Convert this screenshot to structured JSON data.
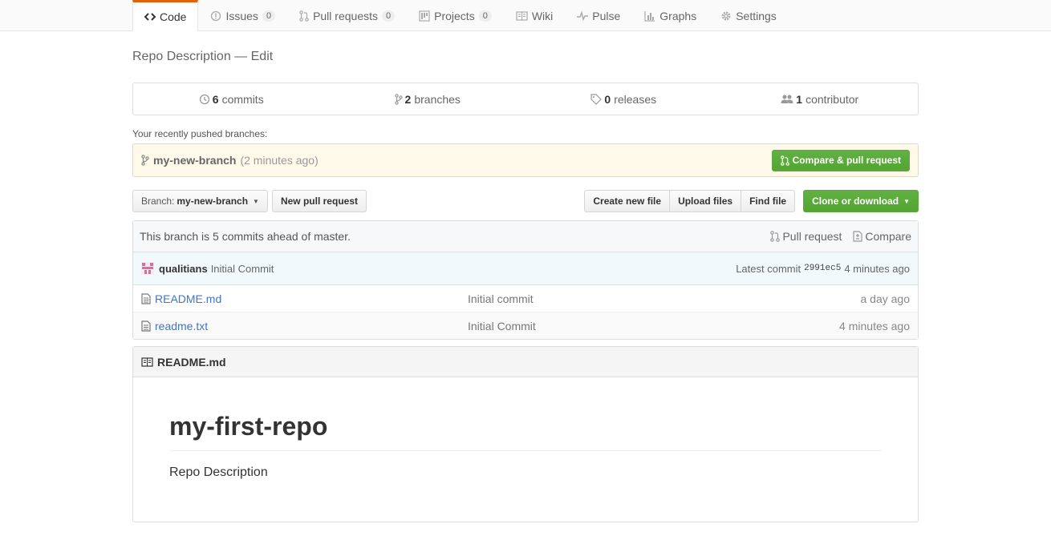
{
  "nav": {
    "tabs": [
      {
        "label": "Code",
        "counter": null,
        "icon": "code-icon",
        "selected": true
      },
      {
        "label": "Issues",
        "counter": "0",
        "icon": "issue-icon"
      },
      {
        "label": "Pull requests",
        "counter": "0",
        "icon": "pull-request-icon"
      },
      {
        "label": "Projects",
        "counter": "0",
        "icon": "project-icon"
      },
      {
        "label": "Wiki",
        "counter": null,
        "icon": "book-icon"
      },
      {
        "label": "Pulse",
        "counter": null,
        "icon": "pulse-icon"
      },
      {
        "label": "Graphs",
        "counter": null,
        "icon": "graph-icon"
      },
      {
        "label": "Settings",
        "counter": null,
        "icon": "gear-icon"
      }
    ],
    "accent": "#e36209"
  },
  "repo": {
    "description": "Repo Description",
    "edit_sep": " — ",
    "edit_label": "Edit"
  },
  "summary": {
    "commits_count": "6",
    "commits_label": "commits",
    "branches_count": "2",
    "branches_label": "branches",
    "releases_count": "0",
    "releases_label": "releases",
    "contributors_count": "1",
    "contributors_label": "contributor"
  },
  "recent": {
    "label": "Your recently pushed branches:",
    "branch": "my-new-branch",
    "ago": "(2 minutes ago)",
    "compare_button": "Compare & pull request"
  },
  "toolbar": {
    "branch_prefix": "Branch:",
    "branch_name": "my-new-branch",
    "new_pr": "New pull request",
    "create_file": "Create new file",
    "upload_files": "Upload files",
    "find_file": "Find file",
    "clone": "Clone or download",
    "green": "#55a532"
  },
  "files": {
    "ahead_text": "This branch is 5 commits ahead of master.",
    "pull_request_link": "Pull request",
    "compare_link": "Compare",
    "commit": {
      "author": "qualitians",
      "message": "Initial Commit",
      "latest_label": "Latest commit",
      "sha": "2991ec5",
      "ago": "4 minutes ago"
    },
    "rows": [
      {
        "name": "README.md",
        "message": "Initial commit",
        "age": "a day ago"
      },
      {
        "name": "readme.txt",
        "message": "Initial Commit",
        "age": "4 minutes ago"
      }
    ]
  },
  "readme": {
    "filename": "README.md",
    "heading": "my-first-repo",
    "body": "Repo Description"
  }
}
